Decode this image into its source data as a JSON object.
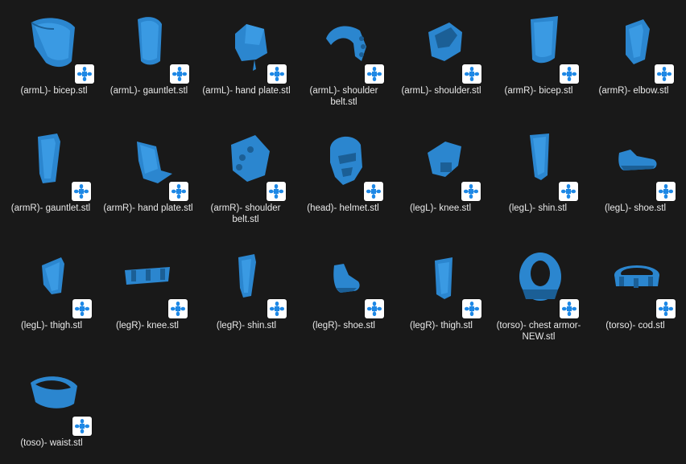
{
  "window": {
    "background": "#191919",
    "accent": "#2f8fd8",
    "model_color": "#2f8fd8"
  },
  "files": [
    {
      "name": "(armL)- bicep.stl",
      "icon": "stl-model-thumbnail-bicep"
    },
    {
      "name": "(armL)- gauntlet.stl",
      "icon": "stl-model-thumbnail-gauntlet"
    },
    {
      "name": "(armL)- hand plate.stl",
      "icon": "stl-model-thumbnail-hand-plate"
    },
    {
      "name": "(armL)- shoulder belt.stl",
      "icon": "stl-model-thumbnail-shoulder-belt"
    },
    {
      "name": "(armL)- shoulder.stl",
      "icon": "stl-model-thumbnail-shoulder"
    },
    {
      "name": "(armR)- bicep.stl",
      "icon": "stl-model-thumbnail-bicep"
    },
    {
      "name": "(armR)- elbow.stl",
      "icon": "stl-model-thumbnail-elbow"
    },
    {
      "name": "(armR)- gauntlet.stl",
      "icon": "stl-model-thumbnail-gauntlet"
    },
    {
      "name": "(armR)- hand plate.stl",
      "icon": "stl-model-thumbnail-hand-plate"
    },
    {
      "name": "(armR)- shoulder belt.stl",
      "icon": "stl-model-thumbnail-shoulder-belt"
    },
    {
      "name": "(head)- helmet.stl",
      "icon": "stl-model-thumbnail-helmet"
    },
    {
      "name": "(legL)- knee.stl",
      "icon": "stl-model-thumbnail-knee"
    },
    {
      "name": "(legL)- shin.stl",
      "icon": "stl-model-thumbnail-shin"
    },
    {
      "name": "(legL)- shoe.stl",
      "icon": "stl-model-thumbnail-shoe"
    },
    {
      "name": "(legL)- thigh.stl",
      "icon": "stl-model-thumbnail-thigh"
    },
    {
      "name": "(legR)- knee.stl",
      "icon": "stl-model-thumbnail-knee-band"
    },
    {
      "name": "(legR)- shin.stl",
      "icon": "stl-model-thumbnail-shin"
    },
    {
      "name": "(legR)- shoe.stl",
      "icon": "stl-model-thumbnail-shoe"
    },
    {
      "name": "(legR)- thigh.stl",
      "icon": "stl-model-thumbnail-thigh"
    },
    {
      "name": "(torso)- chest armor- NEW.stl",
      "icon": "stl-model-thumbnail-chest-armor"
    },
    {
      "name": "(torso)- cod.stl",
      "icon": "stl-model-thumbnail-cod"
    },
    {
      "name": "(toso)- waist.stl",
      "icon": "stl-model-thumbnail-waist"
    }
  ],
  "badge": {
    "icon": "3d-viewer-app-icon",
    "color": "#1e88e5"
  }
}
